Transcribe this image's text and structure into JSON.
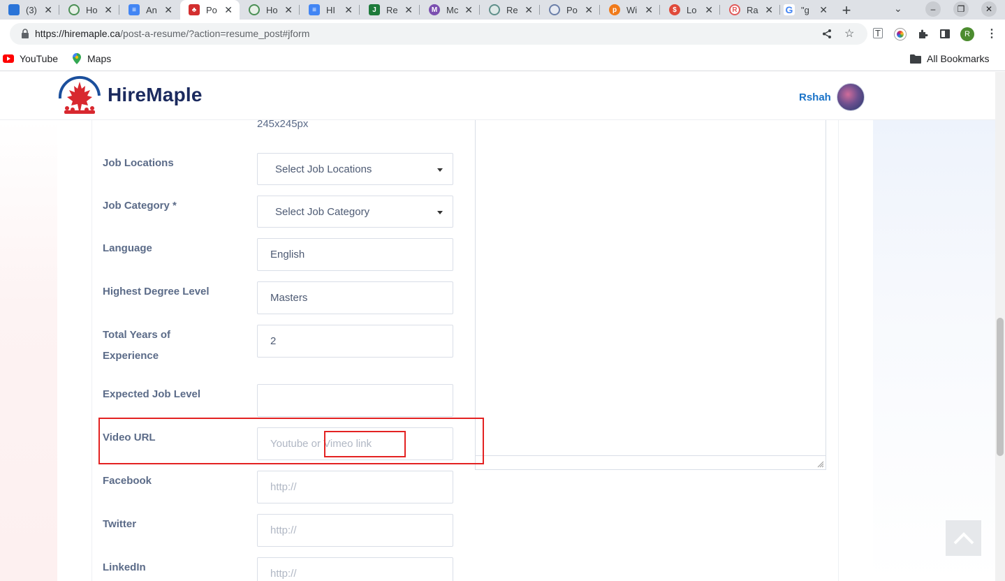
{
  "browser": {
    "tabs": [
      {
        "title": "(3)",
        "favicon": "bluebox-icon",
        "color": "#2a74d8"
      },
      {
        "title": "Ho",
        "favicon": "chrome-icon",
        "color": "#4a8f54"
      },
      {
        "title": "An",
        "favicon": "docs-icon",
        "color": "#4285f4"
      },
      {
        "title": "Po",
        "favicon": "hiremaple-icon",
        "color": "#d32f2f"
      },
      {
        "title": "Ho",
        "favicon": "chrome-icon",
        "color": "#4a8f54"
      },
      {
        "title": "HI",
        "favicon": "docs-icon",
        "color": "#4285f4"
      },
      {
        "title": "Re",
        "favicon": "j-icon",
        "color": "#1d7a3a"
      },
      {
        "title": "Mc",
        "favicon": "m-icon",
        "color": "#7b4fb0"
      },
      {
        "title": "Re",
        "favicon": "gear-icon",
        "color": "#5f8f8a"
      },
      {
        "title": "Po",
        "favicon": "gear-icon",
        "color": "#6b7fa8"
      },
      {
        "title": "Wi",
        "favicon": "p-icon",
        "color": "#f07a1a"
      },
      {
        "title": "Lo",
        "favicon": "s-icon",
        "color": "#e04a3a"
      },
      {
        "title": "Ra",
        "favicon": "r-icon",
        "color": "#e05a5a"
      },
      {
        "title": "\"g",
        "favicon": "google-icon",
        "color": "#4285f4"
      }
    ],
    "new_tab": "+",
    "url_host": "https://hiremaple.ca",
    "url_path": "/post-a-resume/?action=resume_post#jform",
    "profile_initial": "R",
    "bookmarks": [
      {
        "label": "YouTube",
        "icon": "youtube-icon"
      },
      {
        "label": "Maps",
        "icon": "maps-icon"
      }
    ],
    "all_bookmarks": "All Bookmarks"
  },
  "site": {
    "logo_text": "HireMaple",
    "user_name": "Rshah"
  },
  "form": {
    "size_note": "245x245px",
    "fields": [
      {
        "label": "Job Locations",
        "type": "select",
        "value": "Select Job Locations"
      },
      {
        "label": "Job Category *",
        "type": "select",
        "value": "Select Job Category"
      },
      {
        "label": "Language",
        "type": "text",
        "value": "English"
      },
      {
        "label": "Highest Degree Level",
        "type": "text",
        "value": "Masters"
      },
      {
        "label_line1": "Total Years of",
        "label_line2": "Experience",
        "type": "text",
        "value": "2"
      },
      {
        "label": "Expected Job Level",
        "type": "text",
        "value": ""
      },
      {
        "label": "Video URL",
        "type": "text",
        "placeholder": "Youtube or Vimeo link"
      },
      {
        "label": "Facebook",
        "type": "text",
        "placeholder": "http://"
      },
      {
        "label": "Twitter",
        "type": "text",
        "placeholder": "http://"
      },
      {
        "label": "LinkedIn",
        "type": "text",
        "placeholder": "http://"
      }
    ]
  },
  "colors": {
    "accent": "#1a73c8",
    "annotation": "#e32222",
    "brand_navy": "#1b2a5e",
    "brand_red": "#d8282f"
  }
}
